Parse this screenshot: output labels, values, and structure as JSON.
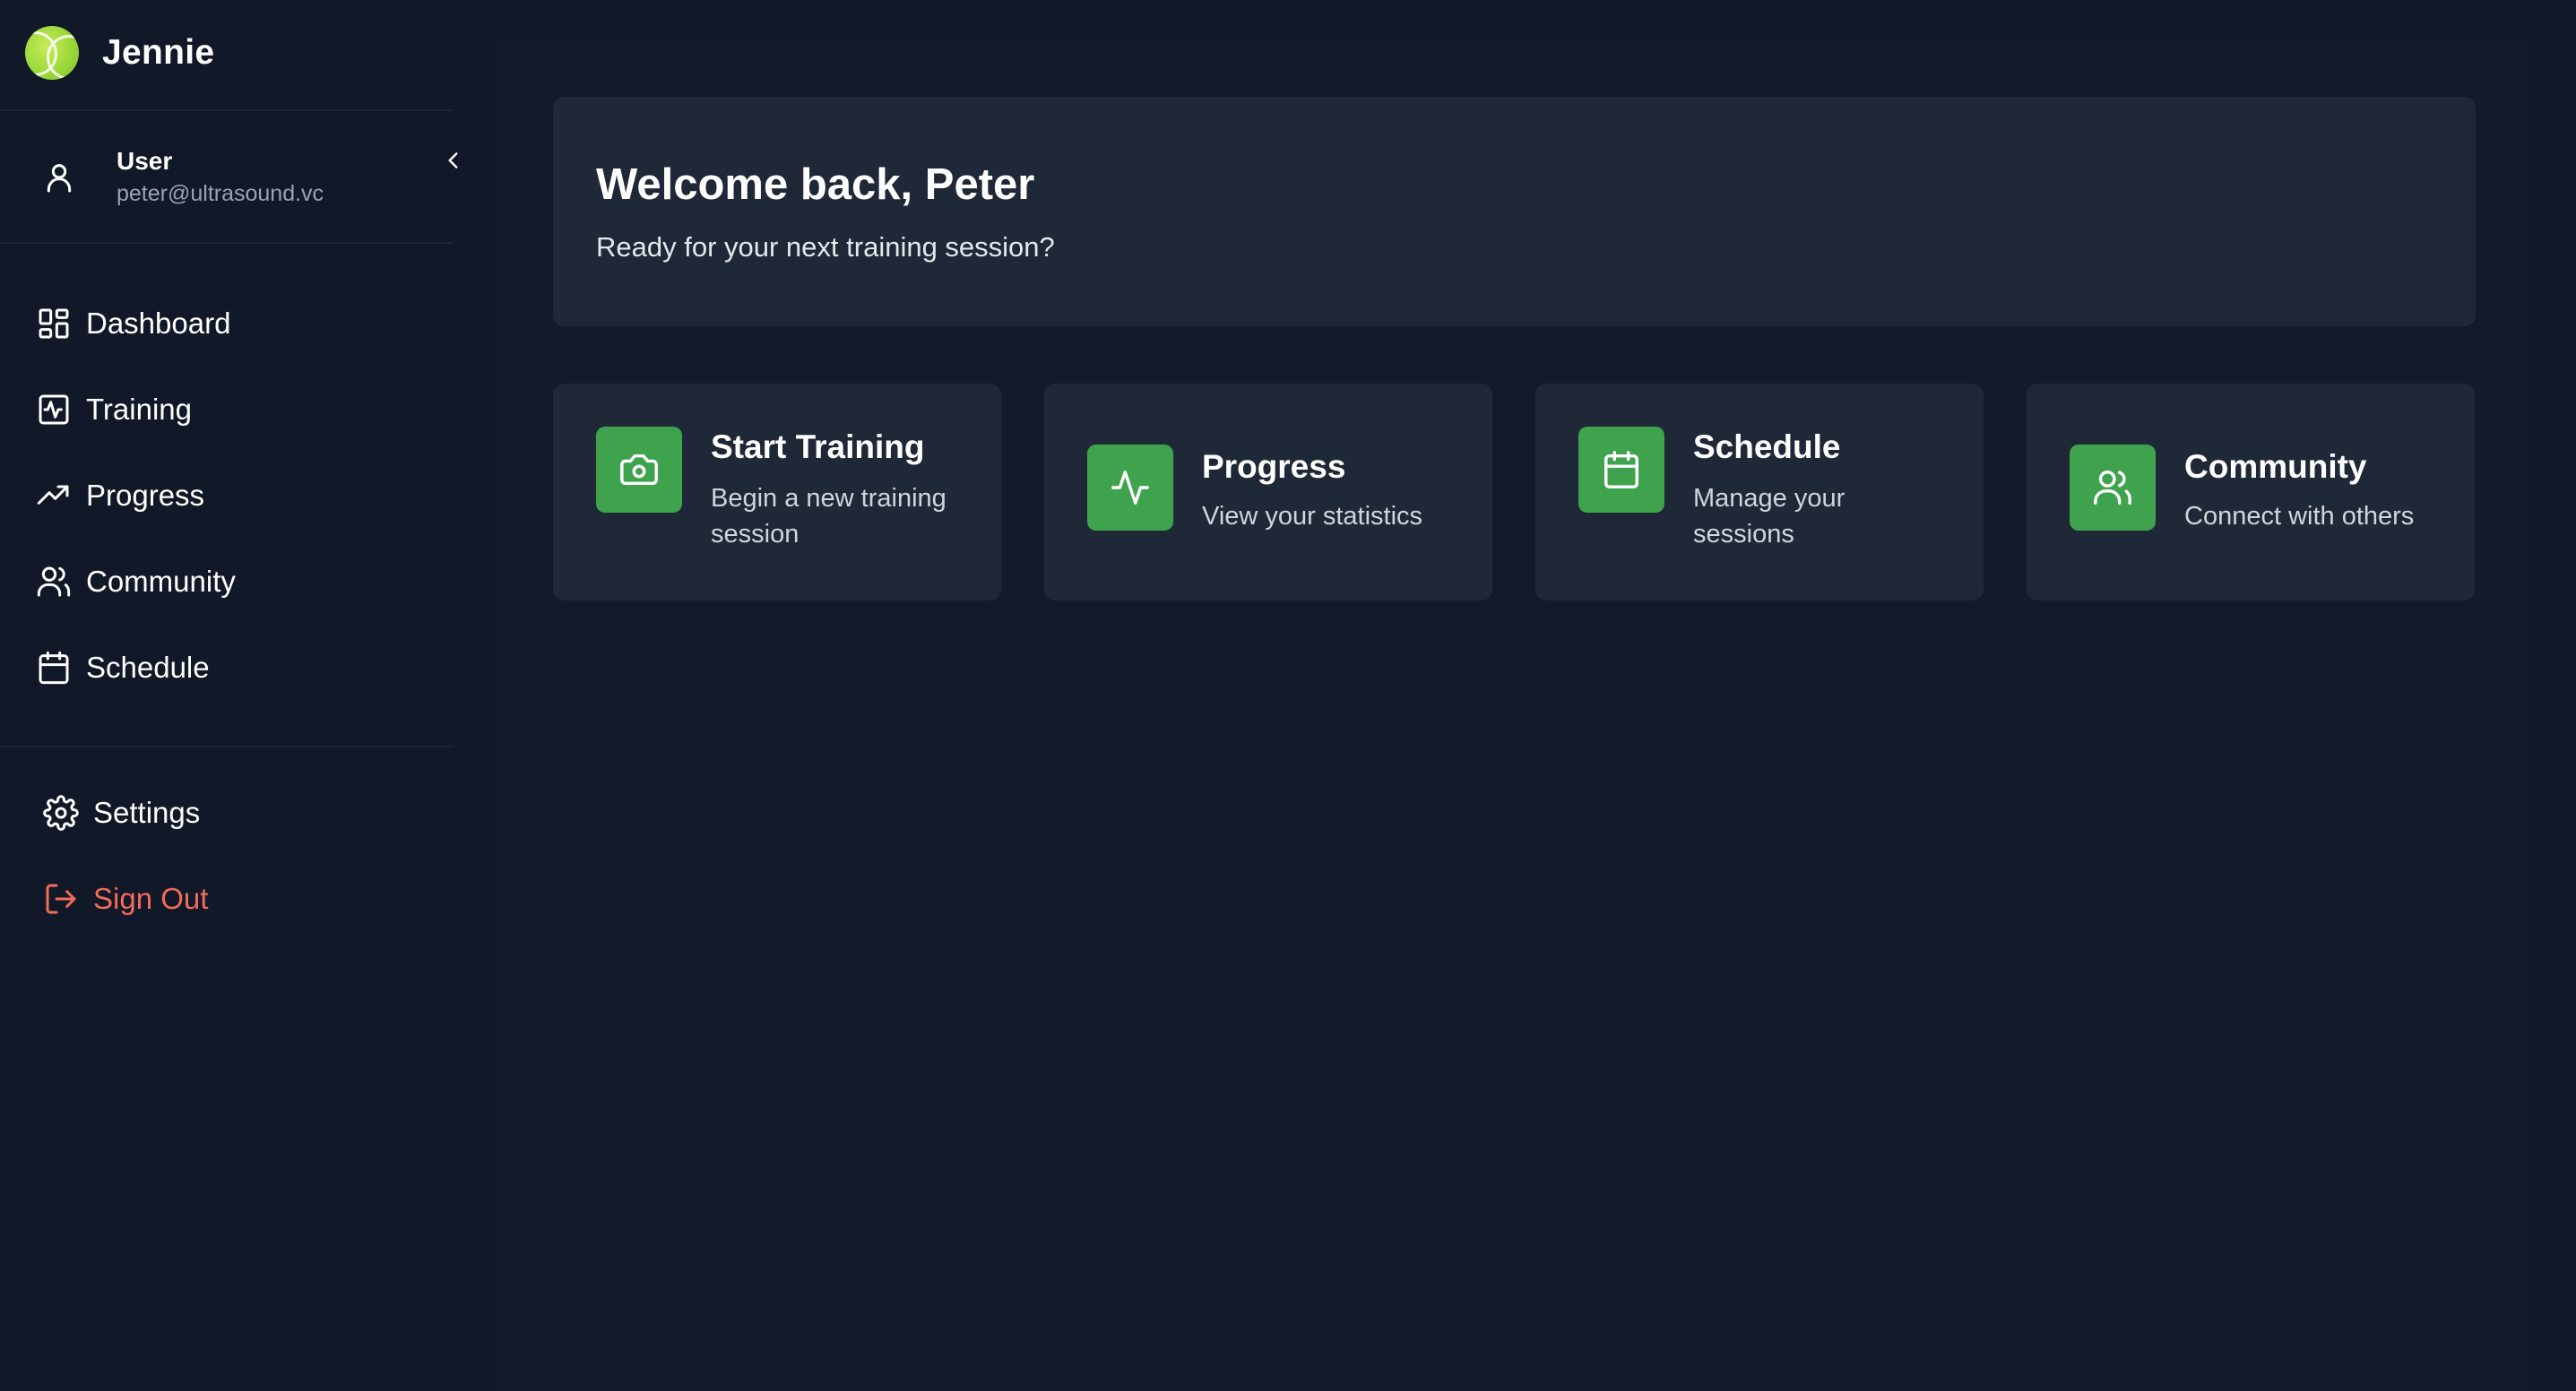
{
  "brand": {
    "name": "Jennie"
  },
  "user": {
    "name": "User",
    "email": "peter@ultrasound.vc"
  },
  "nav": {
    "items": [
      {
        "label": "Dashboard",
        "icon": "dashboard-icon"
      },
      {
        "label": "Training",
        "icon": "activity-square-icon"
      },
      {
        "label": "Progress",
        "icon": "trending-up-icon"
      },
      {
        "label": "Community",
        "icon": "users-icon"
      },
      {
        "label": "Schedule",
        "icon": "calendar-icon"
      }
    ],
    "bottom": [
      {
        "label": "Settings",
        "icon": "gear-icon"
      },
      {
        "label": "Sign Out",
        "icon": "sign-out-icon"
      }
    ]
  },
  "welcome": {
    "title": "Welcome back, Peter",
    "subtitle": "Ready for your next training session?"
  },
  "cards": [
    {
      "title": "Start Training",
      "description": "Begin a new training session",
      "icon": "camera-icon"
    },
    {
      "title": "Progress",
      "description": "View your statistics",
      "icon": "activity-icon"
    },
    {
      "title": "Schedule",
      "description": "Manage your sessions",
      "icon": "calendar-icon"
    },
    {
      "title": "Community",
      "description": "Connect with others",
      "icon": "users-icon"
    }
  ],
  "colors": {
    "background": "#111827",
    "panel": "#1f2837",
    "accent_green": "#3fa34d",
    "sign_out_red": "#f26b5b",
    "muted_text": "#9aa3b2"
  }
}
